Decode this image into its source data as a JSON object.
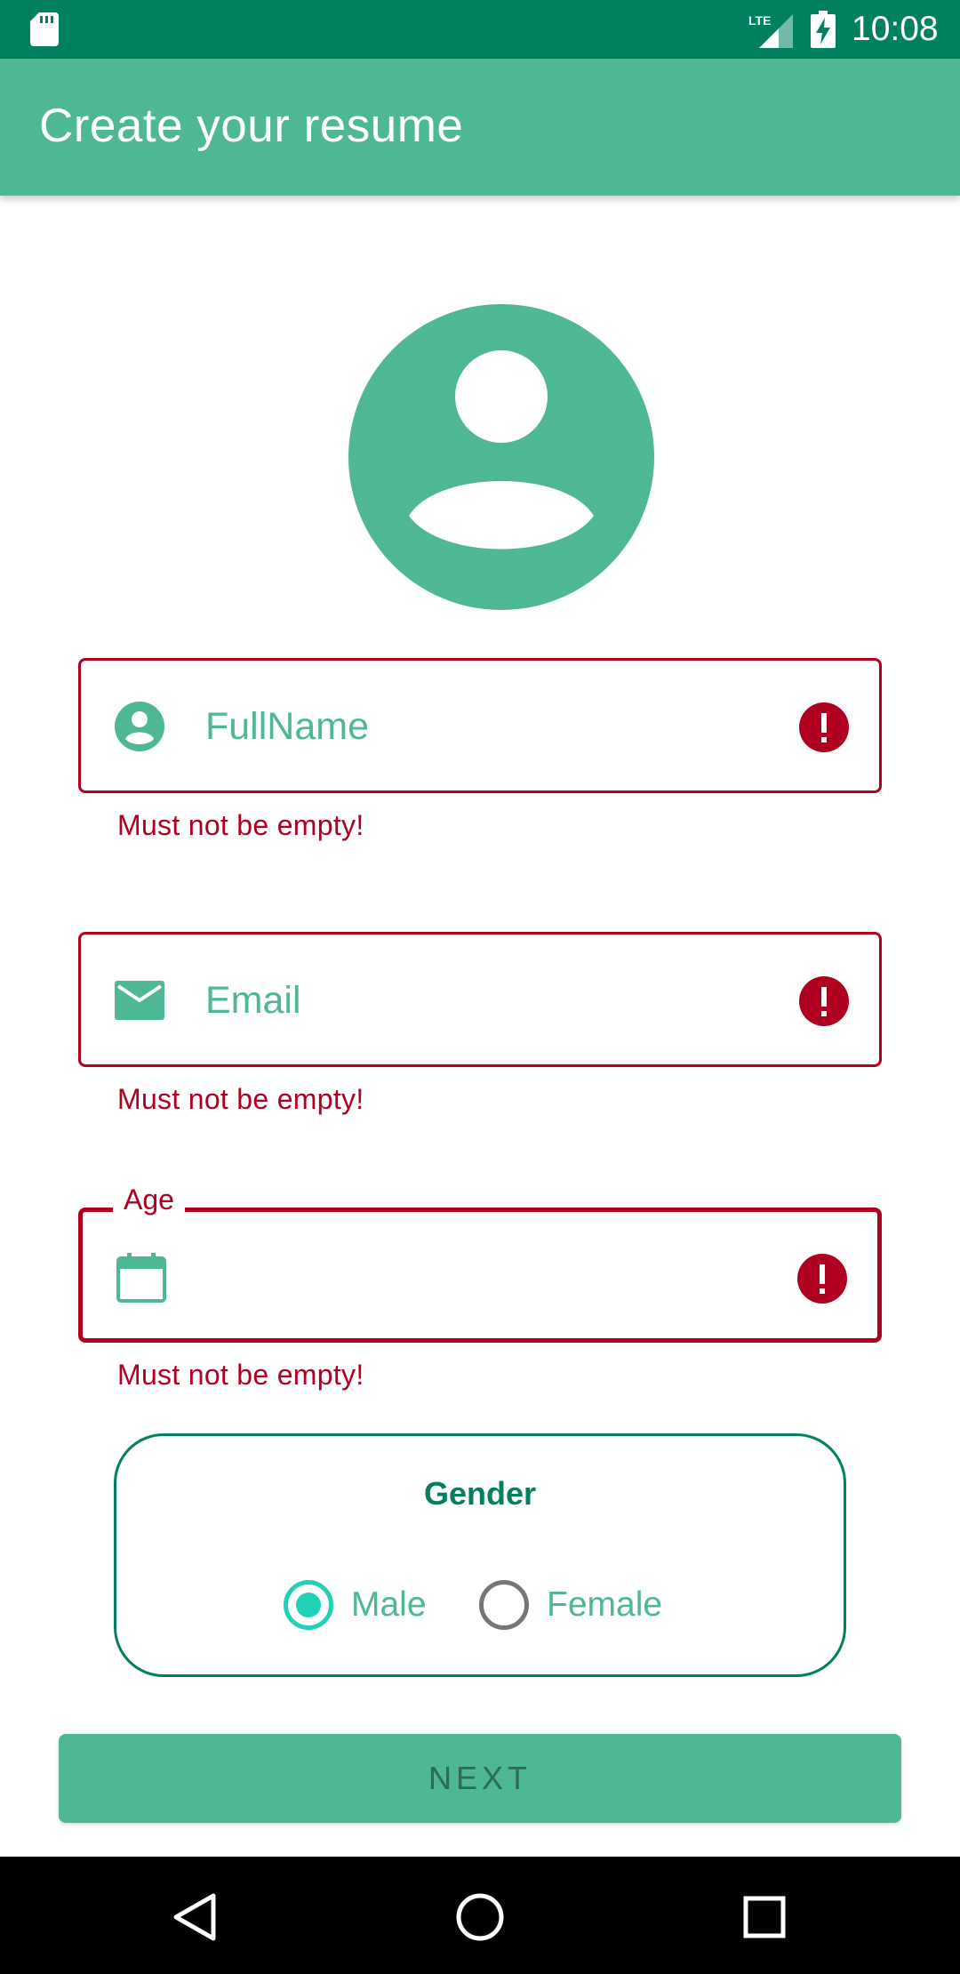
{
  "status_bar": {
    "time": "10:08",
    "network_label": "LTE",
    "icons": [
      "sd-card-icon",
      "cell-signal-icon",
      "battery-charging-icon"
    ]
  },
  "app_bar": {
    "title": "Create your resume"
  },
  "avatar": {
    "icon": "account-circle-icon",
    "color": "#4db891"
  },
  "form": {
    "full_name": {
      "placeholder": "FullName",
      "value": "",
      "error": "Must not be empty!"
    },
    "email": {
      "placeholder": "Email",
      "value": "",
      "error": "Must not be empty!"
    },
    "age": {
      "label": "Age",
      "value": "",
      "error": "Must not be empty!"
    }
  },
  "gender": {
    "title": "Gender",
    "options": [
      {
        "label": "Male",
        "checked": true
      },
      {
        "label": "Female",
        "checked": false
      }
    ]
  },
  "next_button": {
    "label": "NEXT"
  },
  "colors": {
    "primary": "#4db891",
    "primary_dark": "#00805f",
    "error": "#b00020",
    "radio_checked": "#1fd1b5"
  }
}
